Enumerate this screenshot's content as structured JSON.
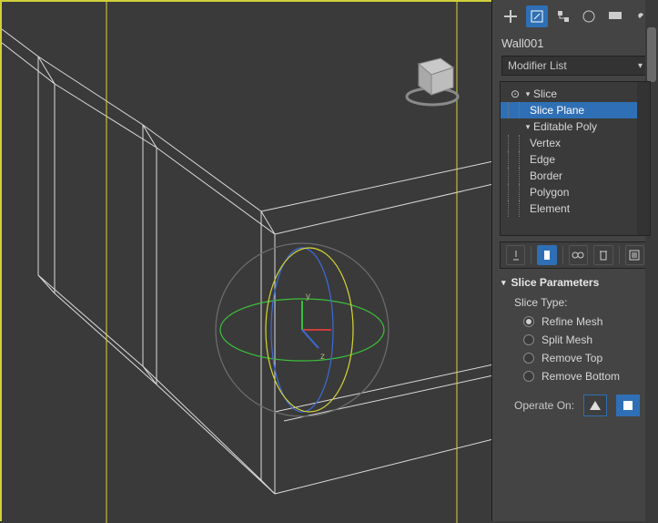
{
  "object_name": "Wall001",
  "modifier_list_label": "Modifier List",
  "stack": {
    "slice": "Slice",
    "slice_plane": "Slice Plane",
    "editable_poly": "Editable Poly",
    "vertex": "Vertex",
    "edge": "Edge",
    "border": "Border",
    "polygon": "Polygon",
    "element": "Element"
  },
  "rollout": {
    "title": "Slice Parameters",
    "slice_type_label": "Slice Type:",
    "options": {
      "refine": "Refine Mesh",
      "split": "Split Mesh",
      "remove_top": "Remove Top",
      "remove_bottom": "Remove Bottom"
    },
    "selected": "refine",
    "operate_on_label": "Operate On:"
  },
  "gizmo": {
    "axis_y": "y",
    "axis_z": "z"
  },
  "colors": {
    "accent": "#2f6fb5",
    "yellow": "#d6d636",
    "wire": "#dadada",
    "gizmo_x": "#cc3b3b",
    "gizmo_y": "#3bbf3b",
    "gizmo_z": "#3b6bd6"
  }
}
